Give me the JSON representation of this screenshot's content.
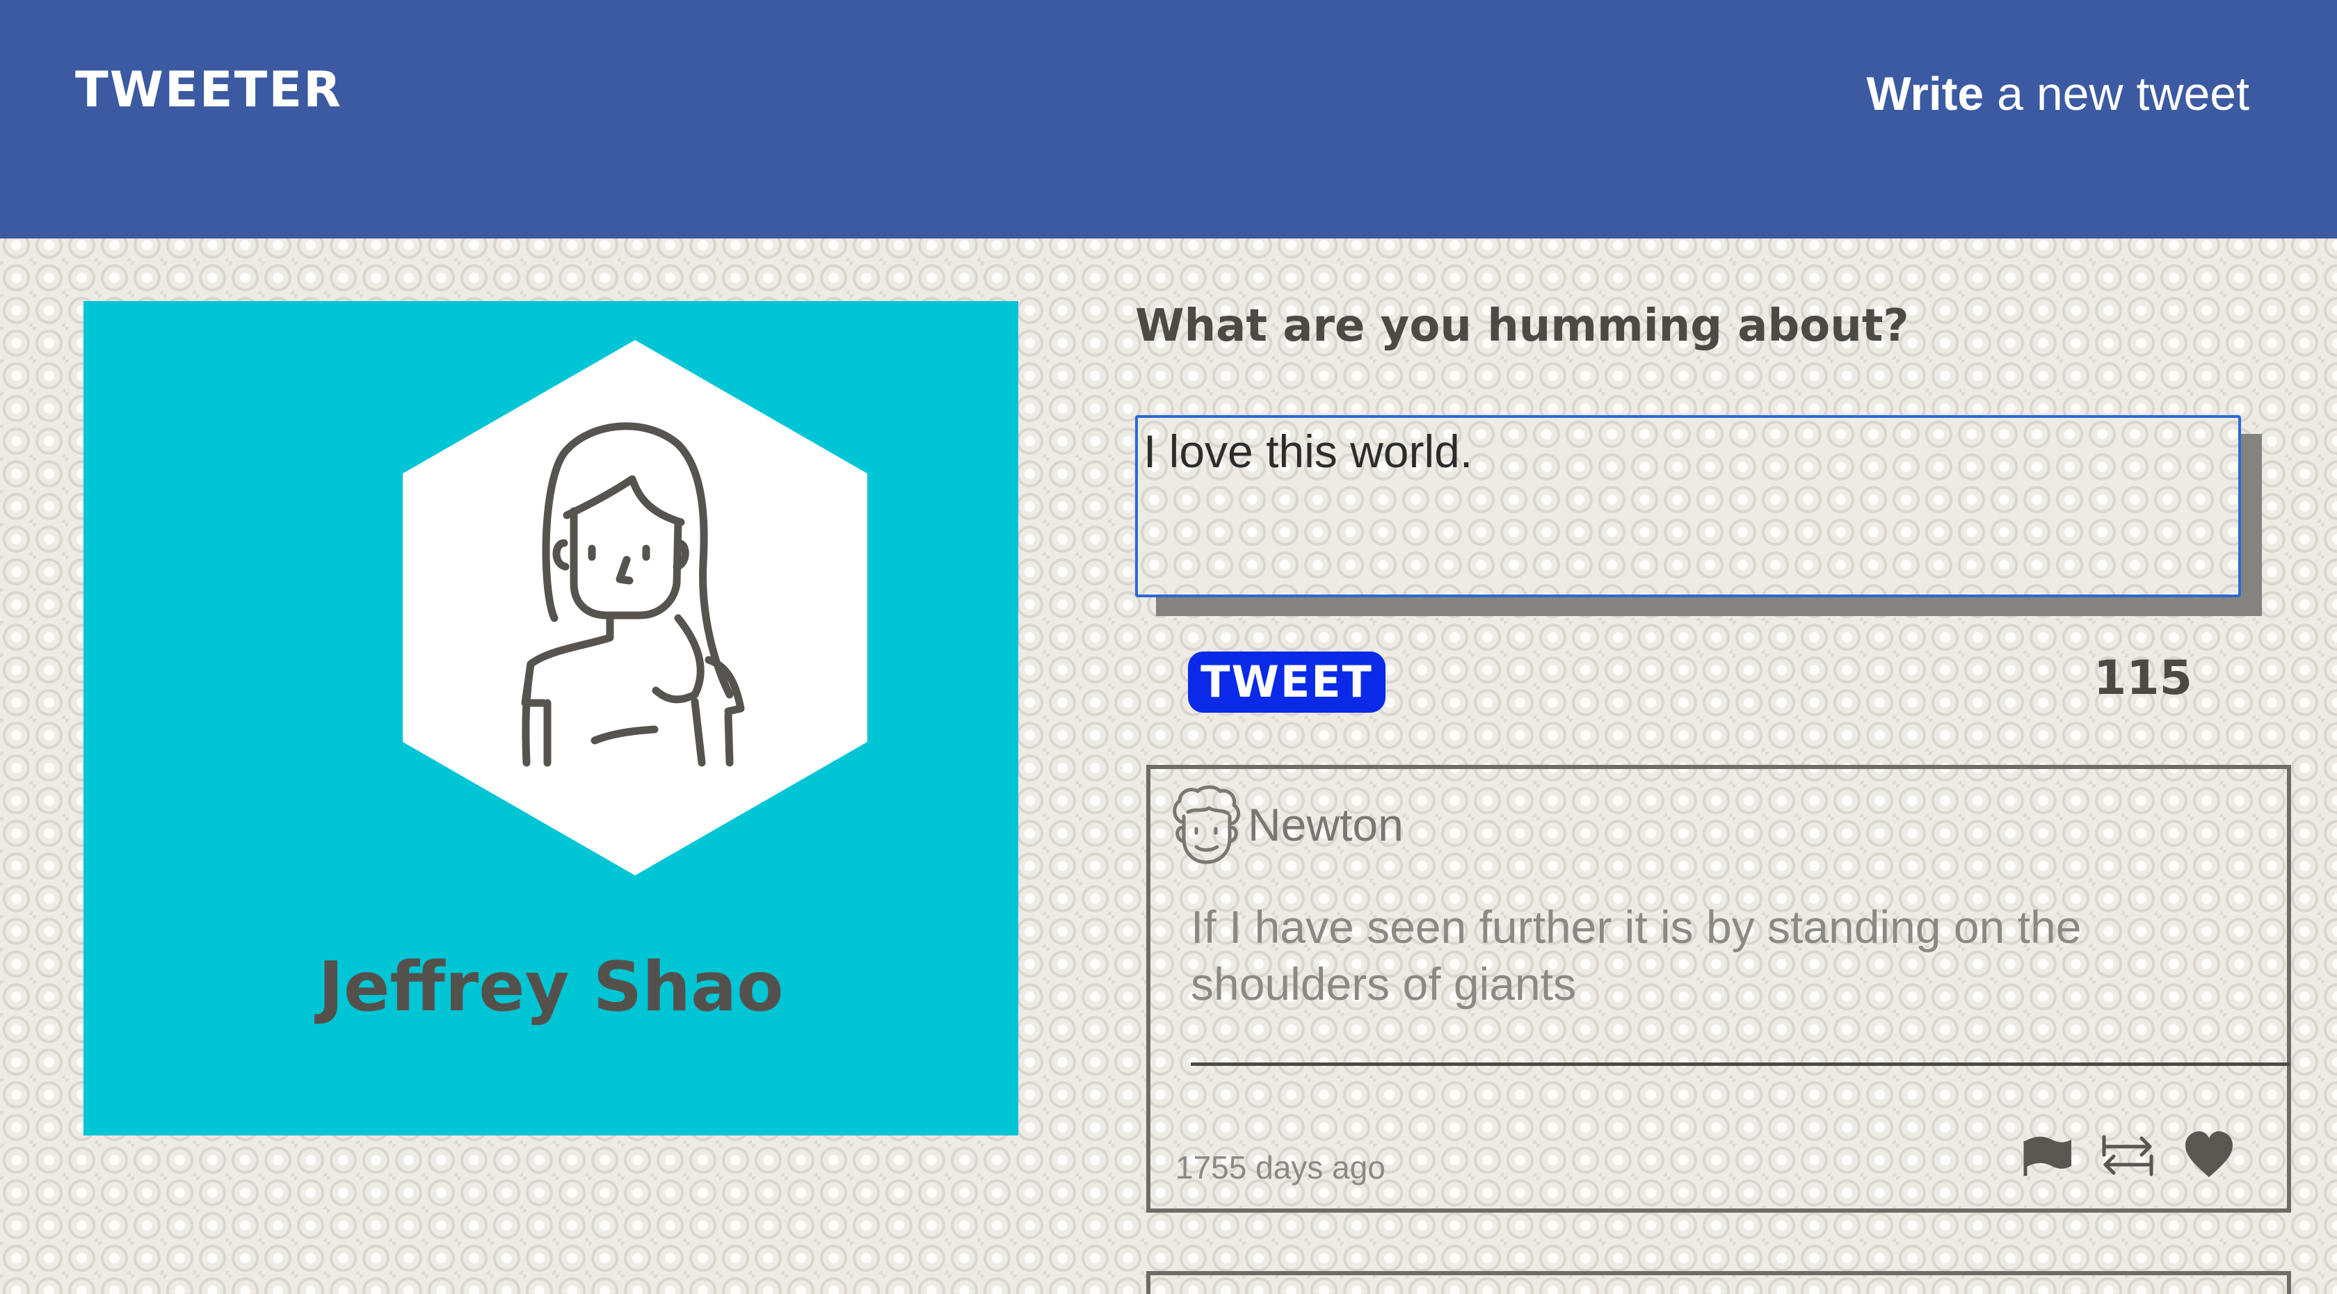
{
  "header": {
    "brand": "TWEETER",
    "compose_bold": "Write",
    "compose_rest": " a new tweet"
  },
  "profile": {
    "name": "Jeffrey Shao",
    "avatar_icon": "woman-avatar-icon",
    "card_color": "#00c5d4"
  },
  "composer": {
    "question": "What are you humming about?",
    "input_value": "I love this world.",
    "button_label": "TWEET",
    "char_count": "115",
    "button_color": "#0a2ae8"
  },
  "tweets": [
    {
      "author": "Newton",
      "avatar_icon": "man-avatar-icon",
      "text": "If I have seen further it is by standing on the shoulders of giants",
      "time": "1755 days ago",
      "actions": [
        "flag-icon",
        "retweet-icon",
        "heart-icon"
      ]
    }
  ],
  "colors": {
    "header": "#3b5aa2",
    "text_dark": "#4d4a46"
  }
}
